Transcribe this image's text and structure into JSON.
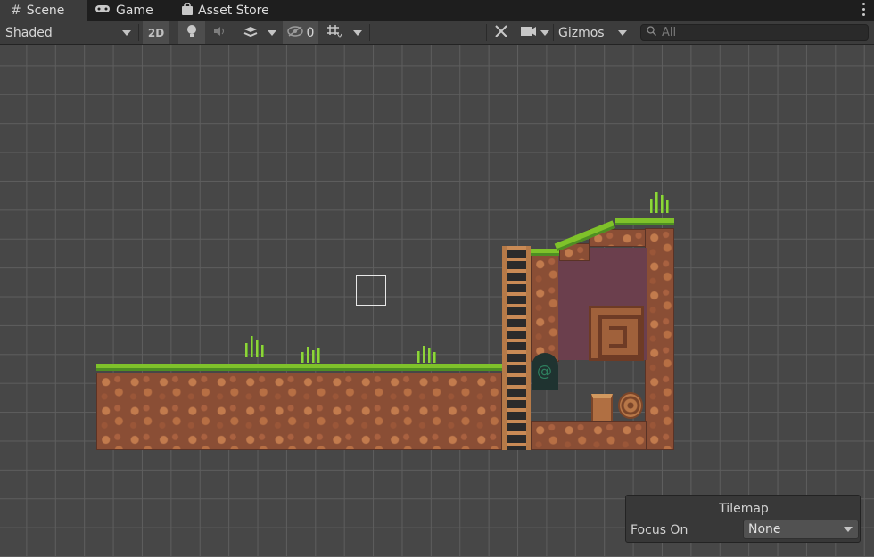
{
  "tabs": [
    {
      "label": "Scene",
      "icon": "hash-icon",
      "active": true
    },
    {
      "label": "Game",
      "icon": "gamepad-icon",
      "active": false
    },
    {
      "label": "Asset Store",
      "icon": "bag-icon",
      "active": false
    }
  ],
  "toolbar": {
    "shading_mode": "Shaded",
    "mode_2d_label": "2D",
    "hidden_count": "0",
    "gizmos_label": "Gizmos",
    "search_placeholder": "All"
  },
  "tilemap_overlay": {
    "title": "Tilemap",
    "focus_label": "Focus On",
    "focus_value": "None"
  },
  "colors": {
    "grid_background": "#474747",
    "grid_line": "#5e5e5e",
    "grass": "#7fc22a",
    "dirt": "#8a4e35"
  }
}
